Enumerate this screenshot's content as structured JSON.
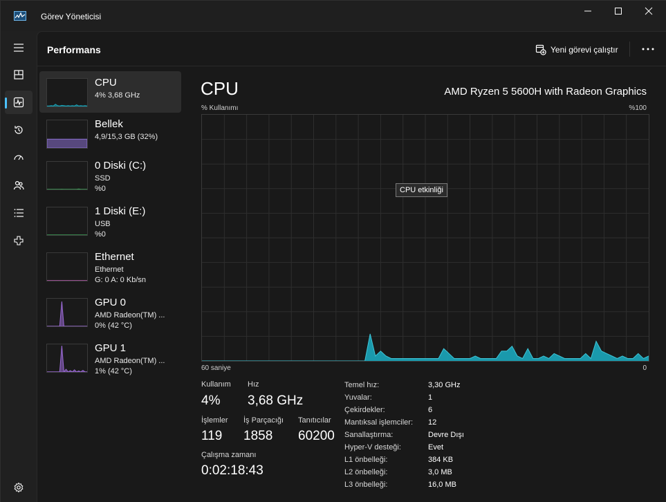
{
  "window": {
    "title": "Görev Yöneticisi",
    "accent": "#4cc2ff",
    "graph_fill": "#1aa0b4",
    "graph_line": "#3ec6d8"
  },
  "nav": {
    "items": [
      {
        "name": "menu-icon"
      },
      {
        "name": "processes-icon"
      },
      {
        "name": "performance-icon",
        "active": true
      },
      {
        "name": "app-history-icon"
      },
      {
        "name": "startup-apps-icon"
      },
      {
        "name": "users-icon"
      },
      {
        "name": "details-icon"
      },
      {
        "name": "services-icon"
      },
      {
        "name": "settings-icon"
      }
    ]
  },
  "header": {
    "title": "Performans",
    "run_task_label": "Yeni görevi çalıştır",
    "more_label": "•••"
  },
  "resources": [
    {
      "name": "CPU",
      "line1": "4% 3,68 GHz",
      "line2": "",
      "selected": true,
      "color": "#1aa0b4",
      "trace": [
        2,
        2,
        3,
        2,
        8,
        3,
        2,
        4,
        3,
        2,
        3,
        2,
        3,
        2,
        6,
        2,
        3,
        2,
        3,
        2
      ]
    },
    {
      "name": "Bellek",
      "line1": "4,9/15,3 GB (32%)",
      "line2": "",
      "color": "#8b6fd0",
      "trace": [
        32,
        32,
        32,
        32,
        32,
        32,
        32,
        32,
        32,
        32,
        32,
        32,
        32,
        32,
        32,
        32,
        32,
        32,
        32,
        32
      ]
    },
    {
      "name": "0 Diski (C:)",
      "line1": "SSD",
      "line2": "%0",
      "color": "#3fa65a",
      "trace": [
        0,
        0,
        0,
        0,
        0,
        0,
        0,
        1,
        0,
        0,
        0,
        0,
        0,
        0,
        0,
        2,
        0,
        0,
        0,
        0
      ]
    },
    {
      "name": "1 Diski (E:)",
      "line1": "USB",
      "line2": "%0",
      "color": "#3fa65a",
      "trace": [
        0,
        0,
        0,
        0,
        0,
        0,
        0,
        0,
        0,
        0,
        0,
        0,
        0,
        0,
        0,
        0,
        0,
        0,
        0,
        0
      ]
    },
    {
      "name": "Ethernet",
      "line1": "Ethernet",
      "line2": "G: 0 A: 0 Kb/sn",
      "color": "#c05fb6",
      "trace": [
        0,
        0,
        0,
        0,
        0,
        0,
        0,
        0,
        0,
        0,
        0,
        0,
        0,
        0,
        0,
        0,
        0,
        0,
        0,
        0
      ]
    },
    {
      "name": "GPU 0",
      "line1": "AMD Radeon(TM) ...",
      "line2": "0% (42 °C)",
      "color": "#9b6ad6",
      "trace": [
        0,
        0,
        0,
        0,
        0,
        0,
        0,
        90,
        0,
        0,
        0,
        0,
        0,
        0,
        0,
        0,
        0,
        0,
        0,
        0
      ]
    },
    {
      "name": "GPU 1",
      "line1": "AMD Radeon(TM) ...",
      "line2": "1% (42 °C)",
      "color": "#9b6ad6",
      "trace": [
        0,
        0,
        0,
        0,
        0,
        0,
        0,
        95,
        0,
        10,
        0,
        5,
        0,
        8,
        0,
        4,
        0,
        6,
        0,
        0
      ]
    }
  ],
  "detail": {
    "title": "CPU",
    "model": "AMD Ryzen 5 5600H with Radeon Graphics",
    "axis_top_left": "% Kullanımı",
    "axis_top_right": "%100",
    "axis_bottom_left": "60 saniye",
    "axis_bottom_right": "0",
    "tooltip": "CPU etkinliği"
  },
  "chart_data": {
    "type": "area",
    "title": "CPU",
    "ylabel": "% Kullanımı",
    "xlabel": "60 saniye",
    "ylim": [
      0,
      100
    ],
    "x_range": [
      60,
      0
    ],
    "grid": true,
    "series": [
      {
        "name": "CPU",
        "values": [
          0,
          0,
          0,
          0,
          0,
          0,
          0,
          0,
          0,
          0,
          0,
          0,
          0,
          0,
          0,
          0,
          0,
          0,
          0,
          0,
          0,
          0,
          0,
          0,
          0,
          0,
          0,
          0,
          0,
          0,
          0,
          0,
          11,
          2,
          4,
          2,
          1,
          1,
          1,
          1,
          1,
          1,
          1,
          1,
          1,
          1,
          5,
          3,
          1,
          1,
          1,
          1,
          2,
          1,
          1,
          1,
          1,
          4,
          4,
          6,
          2,
          1,
          5,
          1,
          1,
          2,
          1,
          3,
          2,
          1,
          1,
          1,
          1,
          3,
          1,
          8,
          4,
          3,
          2,
          1,
          2,
          1,
          1,
          3,
          1,
          2
        ]
      }
    ]
  },
  "stats": {
    "usage_label": "Kullanım",
    "usage_value": "4%",
    "speed_label": "Hız",
    "speed_value": "3,68 GHz",
    "processes_label": "İşlemler",
    "processes_value": "119",
    "threads_label": "İş Parçacığı",
    "threads_value": "1858",
    "handles_label": "Tanıtıcılar",
    "handles_value": "60200",
    "uptime_label": "Çalışma zamanı",
    "uptime_value": "0:02:18:43"
  },
  "specs": [
    {
      "label": "Temel hız:",
      "value": "3,30 GHz"
    },
    {
      "label": "Yuvalar:",
      "value": "1"
    },
    {
      "label": "Çekirdekler:",
      "value": "6"
    },
    {
      "label": "Mantıksal işlemciler:",
      "value": "12"
    },
    {
      "label": "Sanallaştırma:",
      "value": "Devre Dışı"
    },
    {
      "label": "Hyper-V desteği:",
      "value": "Evet"
    },
    {
      "label": "L1 önbelleği:",
      "value": "384 KB"
    },
    {
      "label": "L2 önbelleği:",
      "value": "3,0 MB"
    },
    {
      "label": "L3 önbelleği:",
      "value": "16,0 MB"
    }
  ]
}
